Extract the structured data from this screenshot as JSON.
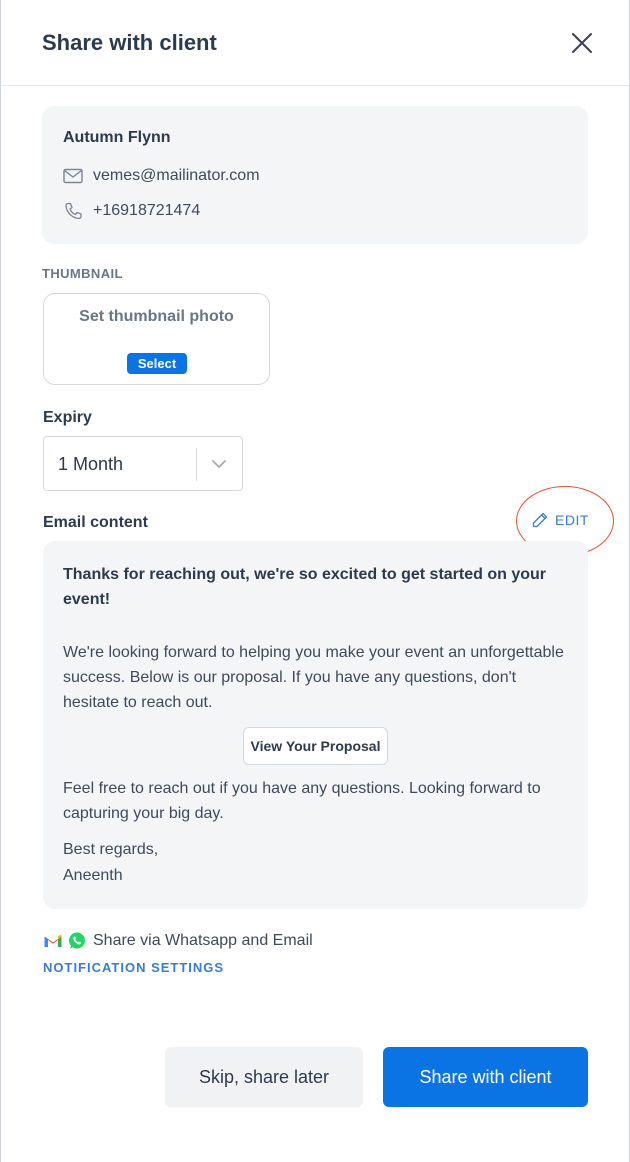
{
  "header": {
    "title": "Share with client"
  },
  "contact": {
    "name": "Autumn Flynn",
    "email": "vemes@mailinator.com",
    "phone": "+16918721474"
  },
  "thumbnail": {
    "section_label": "THUMBNAIL",
    "prompt": "Set thumbnail photo",
    "select_label": "Select"
  },
  "expiry": {
    "label": "Expiry",
    "value": "1 Month"
  },
  "email_content": {
    "label": "Email content",
    "edit_label": "EDIT",
    "heading": "Thanks for reaching out, we're so excited to get started on your event!",
    "intro": "We're looking forward to helping you make your event an unforgettable success. Below is our proposal. If you have any questions, don't hesitate to reach out.",
    "proposal_button": "View Your Proposal",
    "closing": "Feel free to reach out if you have any questions. Looking forward to capturing your big day.",
    "signoff": "Best regards,",
    "signature": "Aneenth"
  },
  "share_via": {
    "text": "Share via Whatsapp and Email"
  },
  "notification_settings": "NOTIFICATION SETTINGS",
  "footer": {
    "skip_label": "Skip, share later",
    "share_label": "Share with client"
  },
  "colors": {
    "primary": "#0b74e5",
    "link": "#3b7bd4",
    "annotation": "#e0543a",
    "card_bg": "#f4f5f7"
  }
}
